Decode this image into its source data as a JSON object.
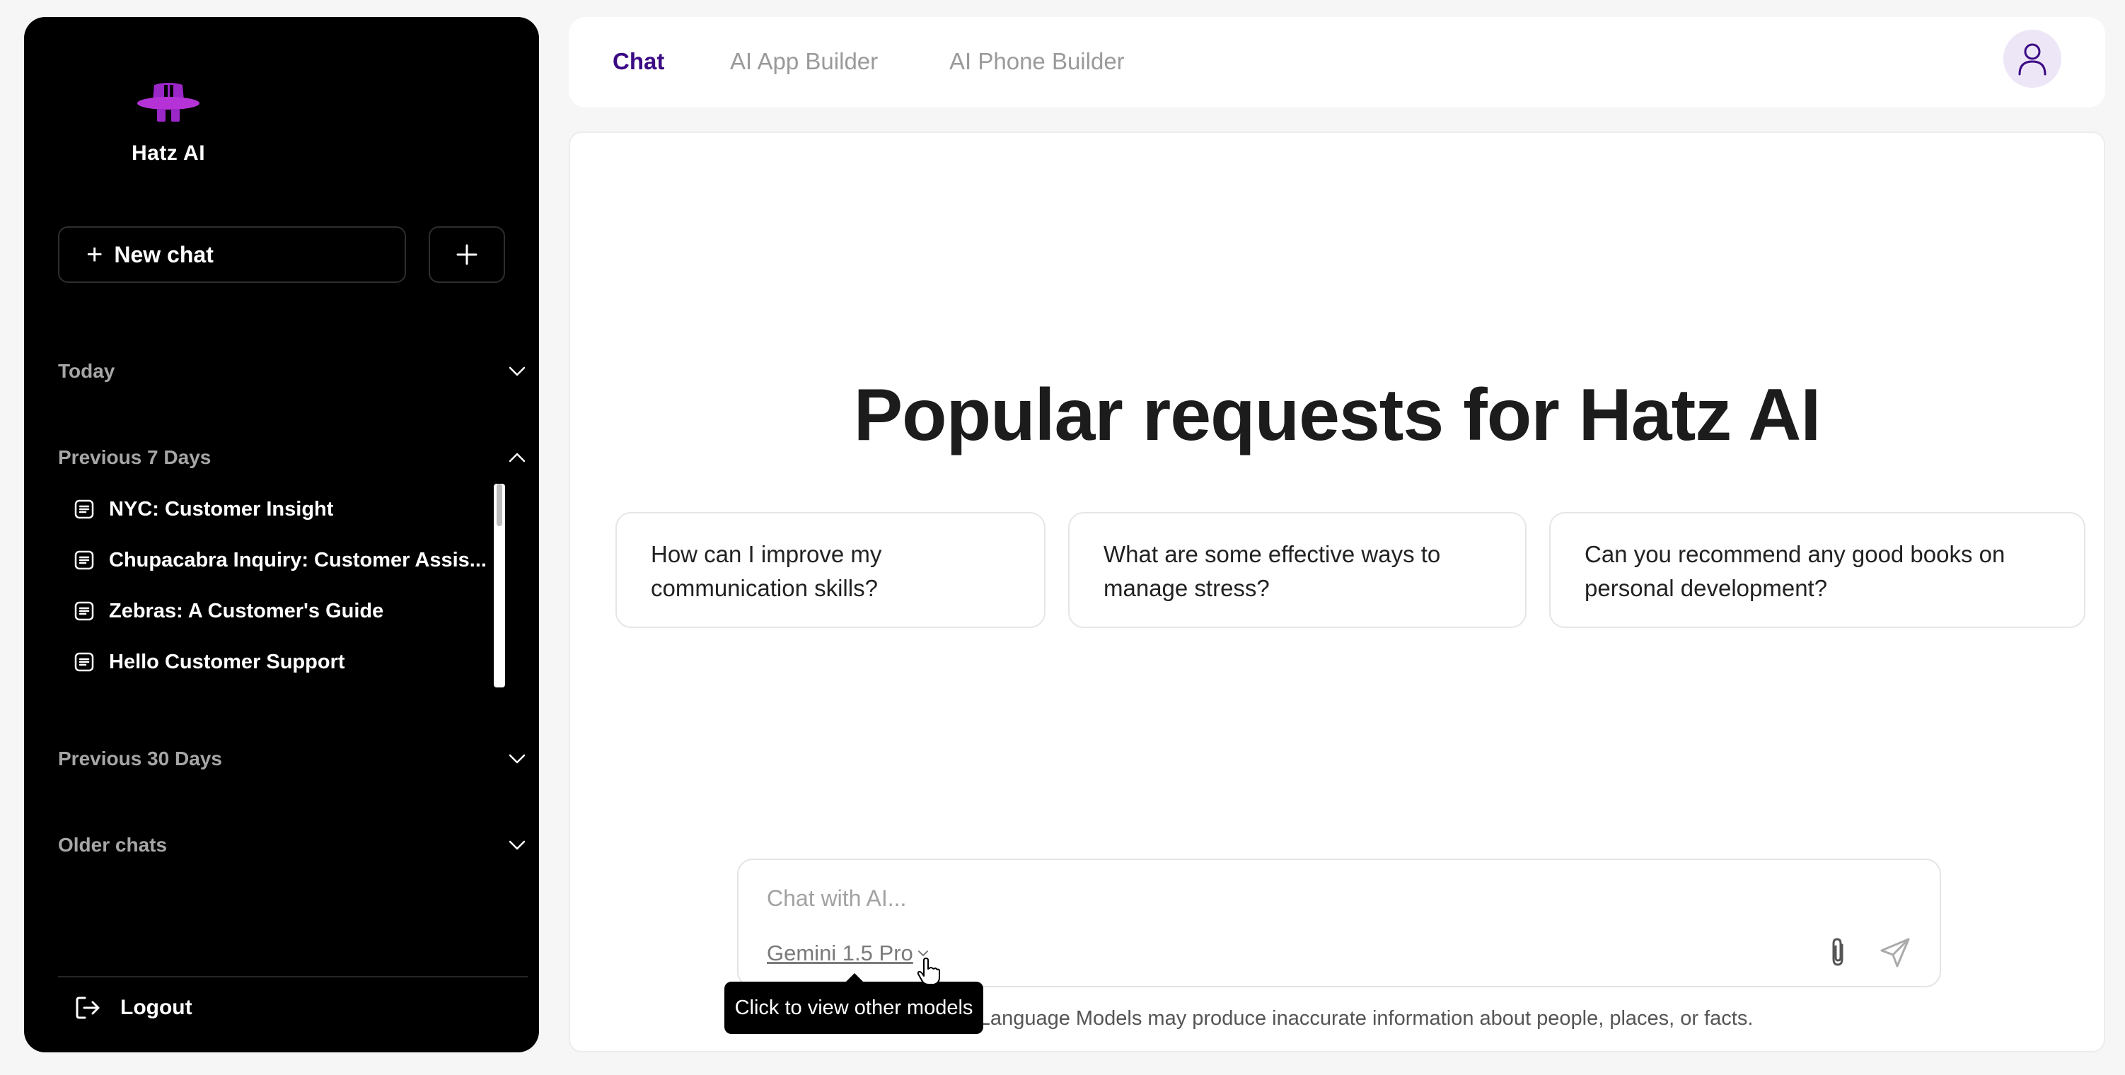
{
  "brand": {
    "name": "Hatz AI",
    "accent": "#9b27c9"
  },
  "sidebar": {
    "new_chat_label": "New chat",
    "sections": [
      {
        "label": "Today",
        "expanded": false
      },
      {
        "label": "Previous 7 Days",
        "expanded": true
      },
      {
        "label": "Previous 30 Days",
        "expanded": false
      },
      {
        "label": "Older chats",
        "expanded": false
      }
    ],
    "recent_chats": [
      "NYC: Customer Insight",
      "Chupacabra Inquiry: Customer Assis...",
      "Zebras: A Customer's Guide",
      "Hello Customer Support"
    ],
    "logout_label": "Logout"
  },
  "topnav": {
    "tabs": [
      {
        "label": "Chat",
        "active": true
      },
      {
        "label": "AI App Builder",
        "active": false
      },
      {
        "label": "AI Phone Builder",
        "active": false
      }
    ],
    "active_color": "#3b0a84"
  },
  "main": {
    "headline": "Popular requests for Hatz AI",
    "suggestions": [
      "How can I improve my communication skills?",
      "What are some effective ways to manage stress?",
      "Can you recommend any good books on personal development?"
    ],
    "composer": {
      "placeholder": "Chat with AI...",
      "model": "Gemini 1.5 Pro",
      "attach_icon": "paperclip-icon",
      "send_icon": "paper-plane-icon"
    },
    "disclaimer": "Large Language Models may produce inaccurate information about people, places, or facts.",
    "tooltip": "Click to view other models"
  }
}
